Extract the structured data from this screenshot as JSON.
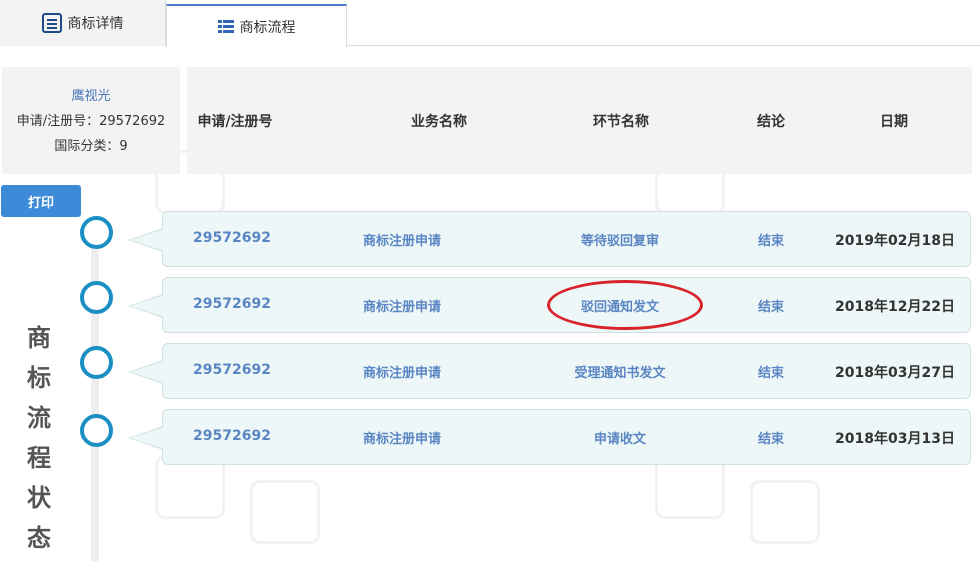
{
  "tabs": [
    {
      "label": "商标详情",
      "icon": "document-icon",
      "active": false
    },
    {
      "label": "商标流程",
      "icon": "list-icon",
      "active": true
    }
  ],
  "info": {
    "brand": "鹰视光",
    "reg_line": "申请/注册号：29572692",
    "class_line": "国际分类：9"
  },
  "table": {
    "headers": [
      "申请/注册号",
      "业务名称",
      "环节名称",
      "结论",
      "日期"
    ],
    "rows": [
      {
        "number": "29572692",
        "business": "商标注册申请",
        "step": "等待驳回复审",
        "result": "结束",
        "date": "2019年02月18日"
      },
      {
        "number": "29572692",
        "business": "商标注册申请",
        "step": "驳回通知发文",
        "result": "结束",
        "date": "2018年12月22日"
      },
      {
        "number": "29572692",
        "business": "商标注册申请",
        "step": "受理通知书发文",
        "result": "结束",
        "date": "2018年03月27日"
      },
      {
        "number": "29572692",
        "business": "商标注册申请",
        "step": "申请收文",
        "result": "结束",
        "date": "2018年03月13日"
      }
    ]
  },
  "print_label": "打印",
  "side_title": [
    "商",
    "标",
    "流",
    "程",
    "状",
    "态"
  ],
  "colors": {
    "accent": "#3d8bd8",
    "node": "#1a8fc4",
    "link": "#5b86c4",
    "highlight": "#d9232a"
  }
}
